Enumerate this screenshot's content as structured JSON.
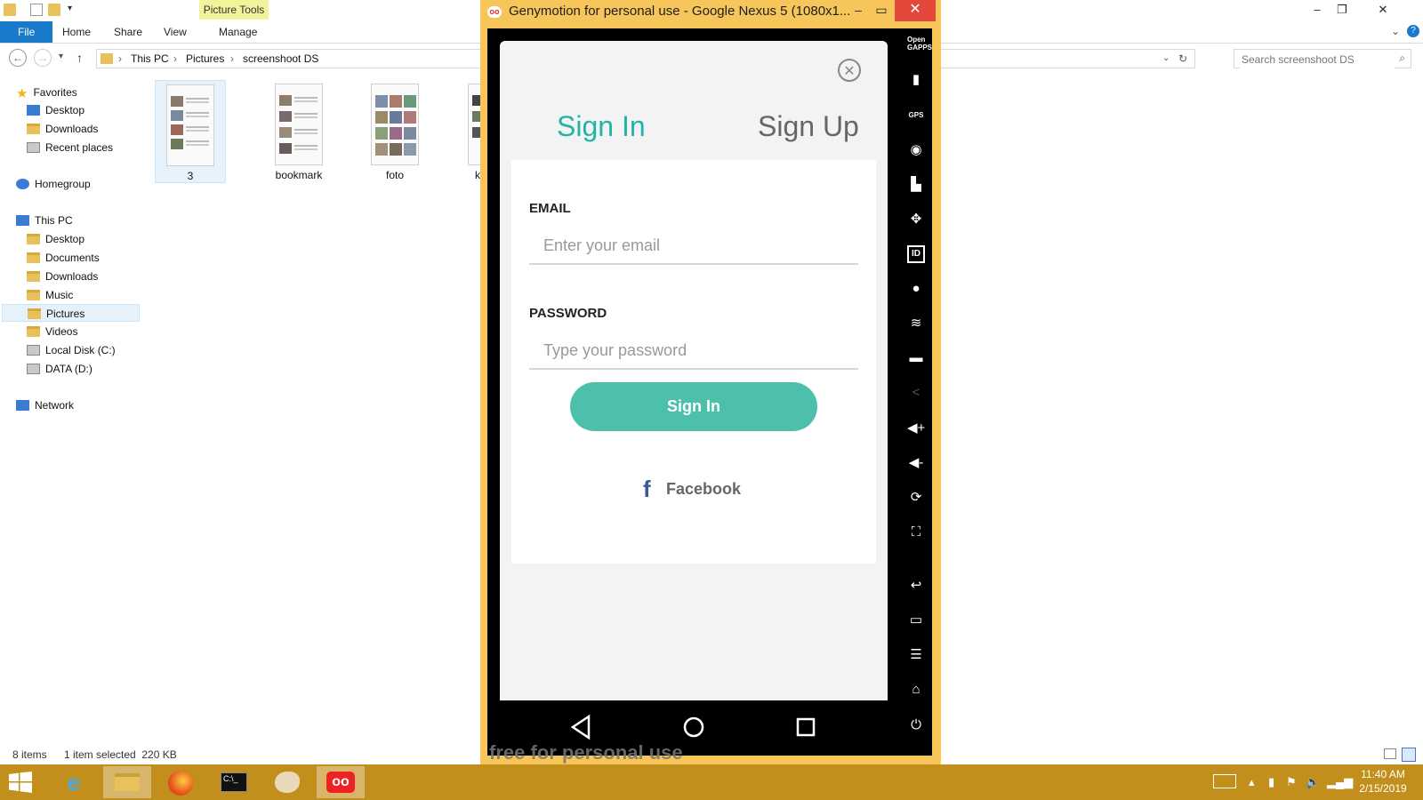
{
  "explorer": {
    "ribbon_context_label": "Picture Tools",
    "tabs": [
      "File",
      "Home",
      "Share",
      "View",
      "Manage"
    ],
    "breadcrumb": [
      "This PC",
      "Pictures",
      "screenshoot DS"
    ],
    "search_placeholder": "Search screenshoot DS",
    "nav": {
      "favorites": "Favorites",
      "favorites_items": [
        "Desktop",
        "Downloads",
        "Recent places"
      ],
      "homegroup": "Homegroup",
      "this_pc": "This PC",
      "this_pc_items": [
        "Desktop",
        "Documents",
        "Downloads",
        "Music",
        "Pictures",
        "Videos",
        "Local Disk (C:)",
        "DATA (D:)"
      ],
      "network": "Network"
    },
    "files": [
      {
        "name": "3",
        "selected": true
      },
      {
        "name": "bookmark",
        "selected": false
      },
      {
        "name": "foto",
        "selected": false
      },
      {
        "name": "k",
        "selected": false
      }
    ],
    "status": {
      "items": "8 items",
      "selection": "1 item selected  220 KB"
    }
  },
  "genymotion": {
    "title": "Genymotion for personal use - Google Nexus 5 (1080x1...",
    "watermark": "free for personal use",
    "sidebar_icons": [
      "open-gapps-icon",
      "battery-icon",
      "gps-icon",
      "camera-icon",
      "clapperboard-icon",
      "dpad-icon",
      "id-icon",
      "disk-icon",
      "rss-icon",
      "sms-icon",
      "share-icon",
      "volume-up-icon",
      "volume-down-icon",
      "rotate-icon",
      "fullscreen-icon",
      "back-icon",
      "recent-apps-icon",
      "menu-icon",
      "home-icon",
      "power-icon"
    ],
    "sidebar_open_gapps": "Open GAPPS",
    "sidebar_gps": "GPS",
    "app": {
      "tabs": {
        "sign_in": "Sign In",
        "sign_up": "Sign Up"
      },
      "email_label": "EMAIL",
      "email_placeholder": "Enter your email",
      "password_label": "PASSWORD",
      "password_placeholder": "Type your password",
      "signin_button": "Sign In",
      "facebook_label": "Facebook"
    }
  },
  "taskbar": {
    "time": "11:40 AM",
    "date": "2/15/2019",
    "colors": {
      "taskbar": "#c28f1c",
      "accent_teal": "#24b3a6",
      "button_teal": "#4dc0ac",
      "geny_frame": "#f6c65a"
    }
  }
}
